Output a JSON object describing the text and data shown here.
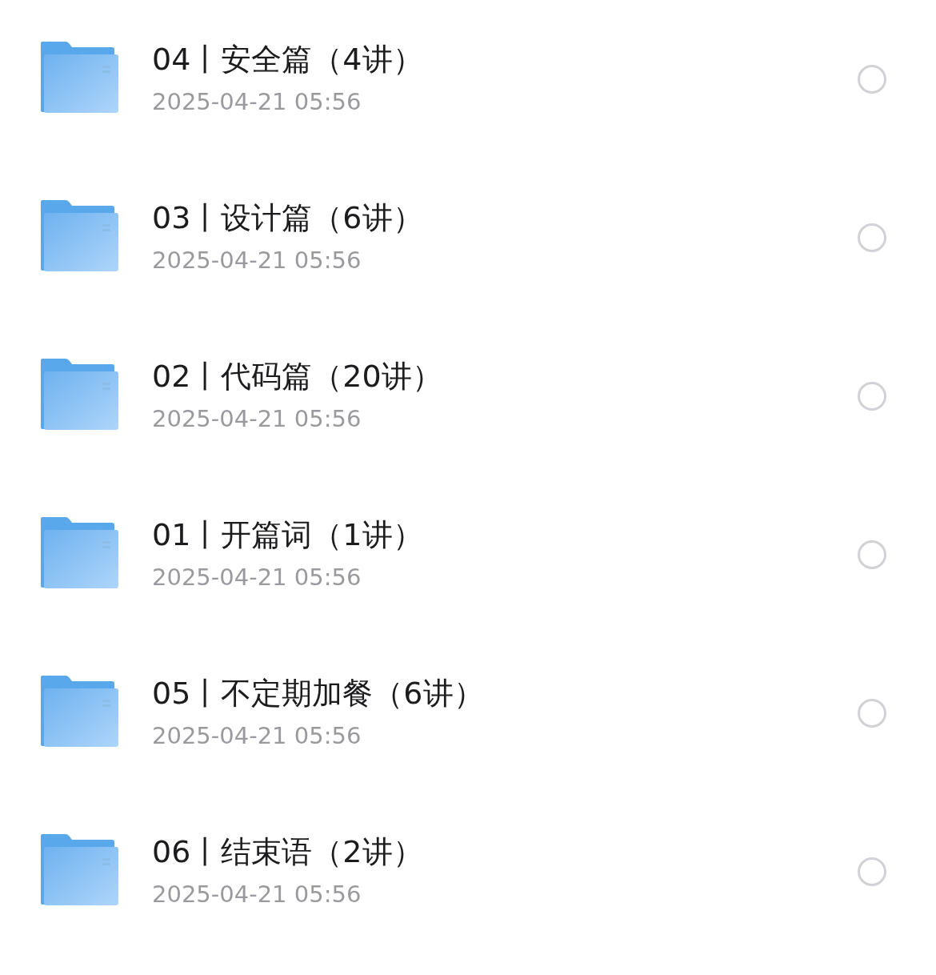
{
  "folders": [
    {
      "title": "04丨安全篇（4讲）",
      "date": "2025-04-21 05:56",
      "selected": false
    },
    {
      "title": "03丨设计篇（6讲）",
      "date": "2025-04-21 05:56",
      "selected": false
    },
    {
      "title": "02丨代码篇（20讲）",
      "date": "2025-04-21 05:56",
      "selected": false
    },
    {
      "title": "01丨开篇词（1讲）",
      "date": "2025-04-21 05:56",
      "selected": false
    },
    {
      "title": "05丨不定期加餐（6讲）",
      "date": "2025-04-21 05:56",
      "selected": false
    },
    {
      "title": "06丨结束语（2讲）",
      "date": "2025-04-21 05:56",
      "selected": false
    }
  ]
}
